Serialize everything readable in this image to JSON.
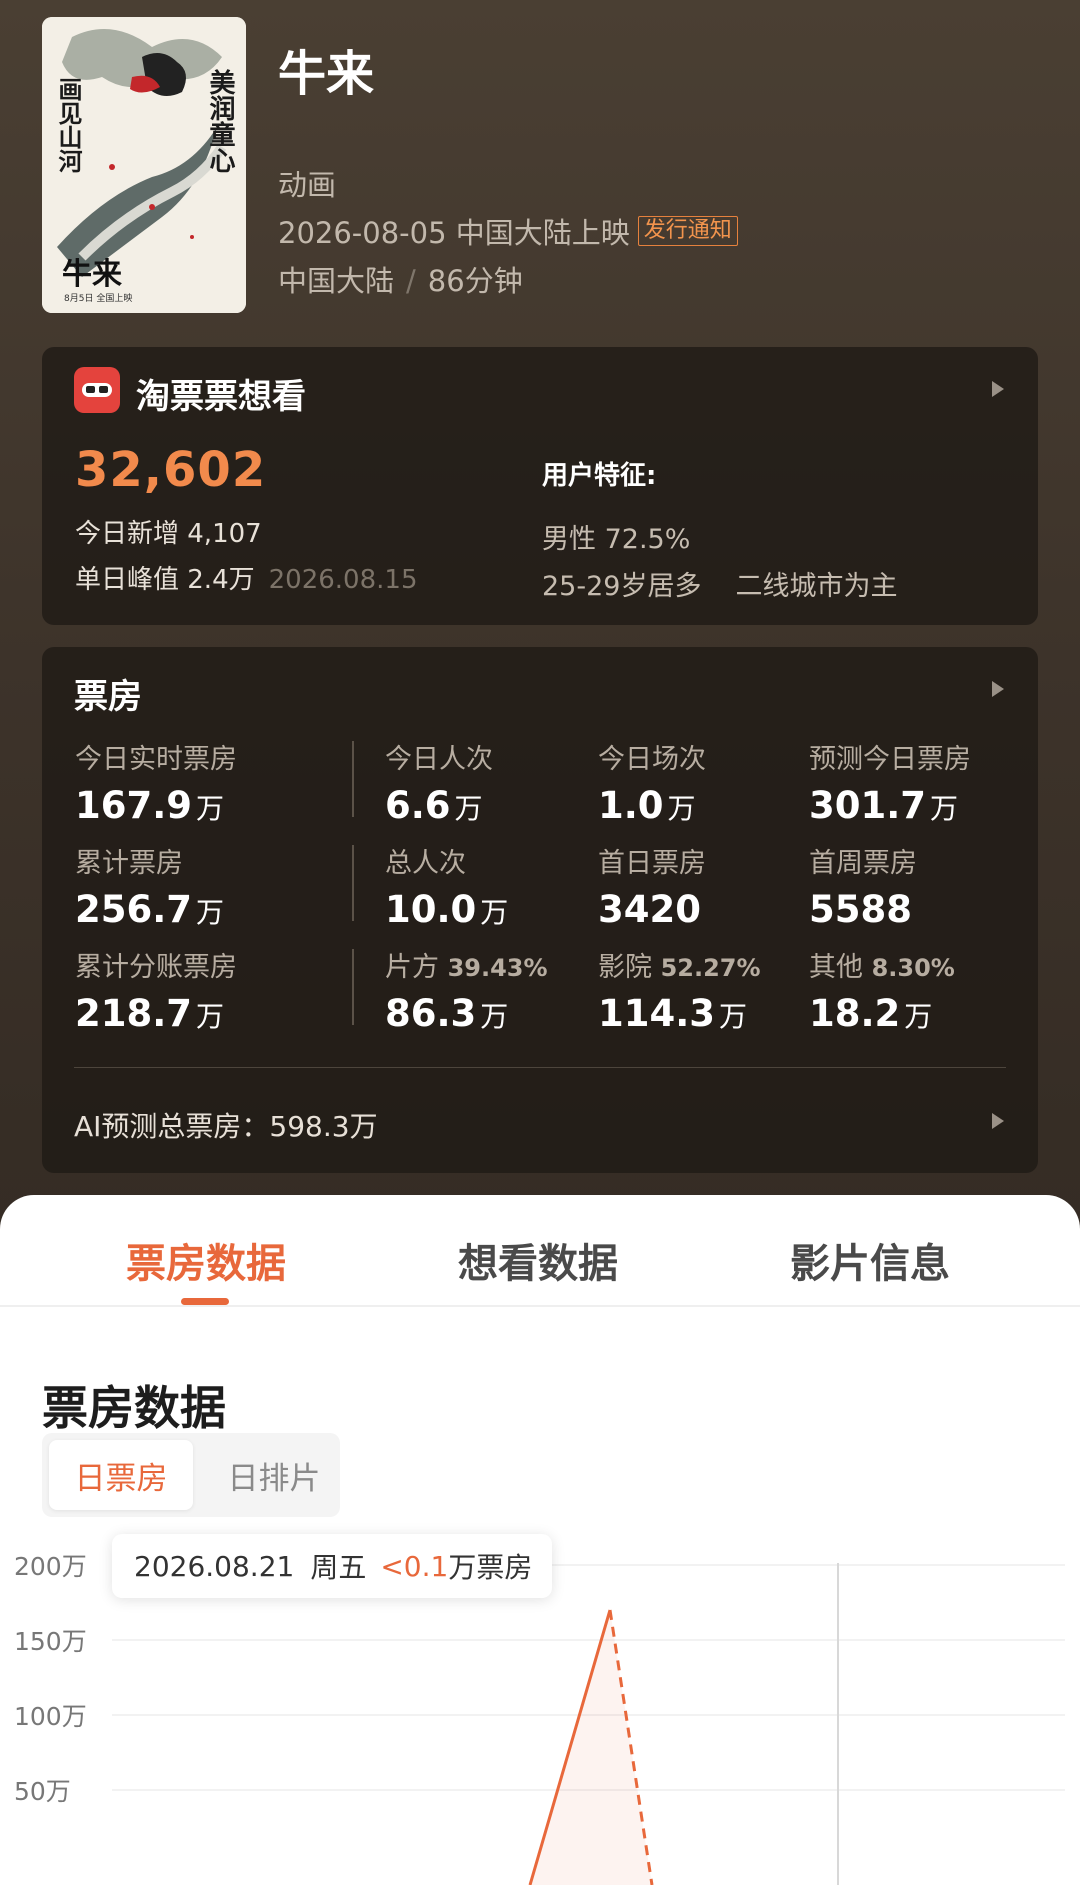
{
  "movie": {
    "title": "牛来",
    "genre": "动画",
    "release": "2026-08-05 中国大陆上映",
    "release_badge": "发行通知",
    "region": "中国大陆",
    "duration": "86分钟",
    "poster": {
      "text_right": "美润童心",
      "text_left": "画见山河",
      "text_title": "牛来",
      "text_date": "8月5日 全国上映"
    }
  },
  "want": {
    "title": "淘票票想看",
    "count": "32,602",
    "today_new": "今日新增 4,107",
    "peak": "单日峰值 2.4万",
    "peak_date": "2026.08.15",
    "features_title": "用户特征:",
    "gender": "男性 72.5%",
    "age": "25-29岁居多",
    "city": "二线城市为主"
  },
  "boxoffice": {
    "title": "票房",
    "stats": [
      {
        "label": "今日实时票房",
        "value": "167.9",
        "unit": "万"
      },
      {
        "label": "今日人次",
        "value": "6.6",
        "unit": "万"
      },
      {
        "label": "今日场次",
        "value": "1.0",
        "unit": "万"
      },
      {
        "label": "预测今日票房",
        "value": "301.7",
        "unit": "万"
      },
      {
        "label": "累计票房",
        "value": "256.7",
        "unit": "万"
      },
      {
        "label": "总人次",
        "value": "10.0",
        "unit": "万"
      },
      {
        "label": "首日票房",
        "value": "3420",
        "unit": ""
      },
      {
        "label": "首周票房",
        "value": "5588",
        "unit": ""
      },
      {
        "label": "累计分账票房",
        "value": "218.7",
        "unit": "万"
      },
      {
        "label": "片方",
        "pct": "39.43%",
        "value": "86.3",
        "unit": "万"
      },
      {
        "label": "影院",
        "pct": "52.27%",
        "value": "114.3",
        "unit": "万"
      },
      {
        "label": "其他",
        "pct": "8.30%",
        "value": "18.2",
        "unit": "万"
      }
    ],
    "ai_forecast": "AI预测总票房：598.3万"
  },
  "tabs": [
    "票房数据",
    "想看数据",
    "影片信息"
  ],
  "section_title": "票房数据",
  "segments": [
    "日票房",
    "日排片"
  ],
  "tooltip": {
    "date": "2026.08.21",
    "weekday": "周五",
    "value": "<0.1",
    "suffix": "万票房"
  },
  "colors": {
    "accent": "#e8683b",
    "want_count": "#f28a4c"
  },
  "chart_data": {
    "type": "line",
    "yticks": [
      "200万",
      "150万",
      "100万",
      "50万"
    ],
    "ylim": [
      0,
      200
    ],
    "series": [
      {
        "values": [
          0,
          170,
          0
        ],
        "style": "solid-then-dashed"
      }
    ]
  }
}
